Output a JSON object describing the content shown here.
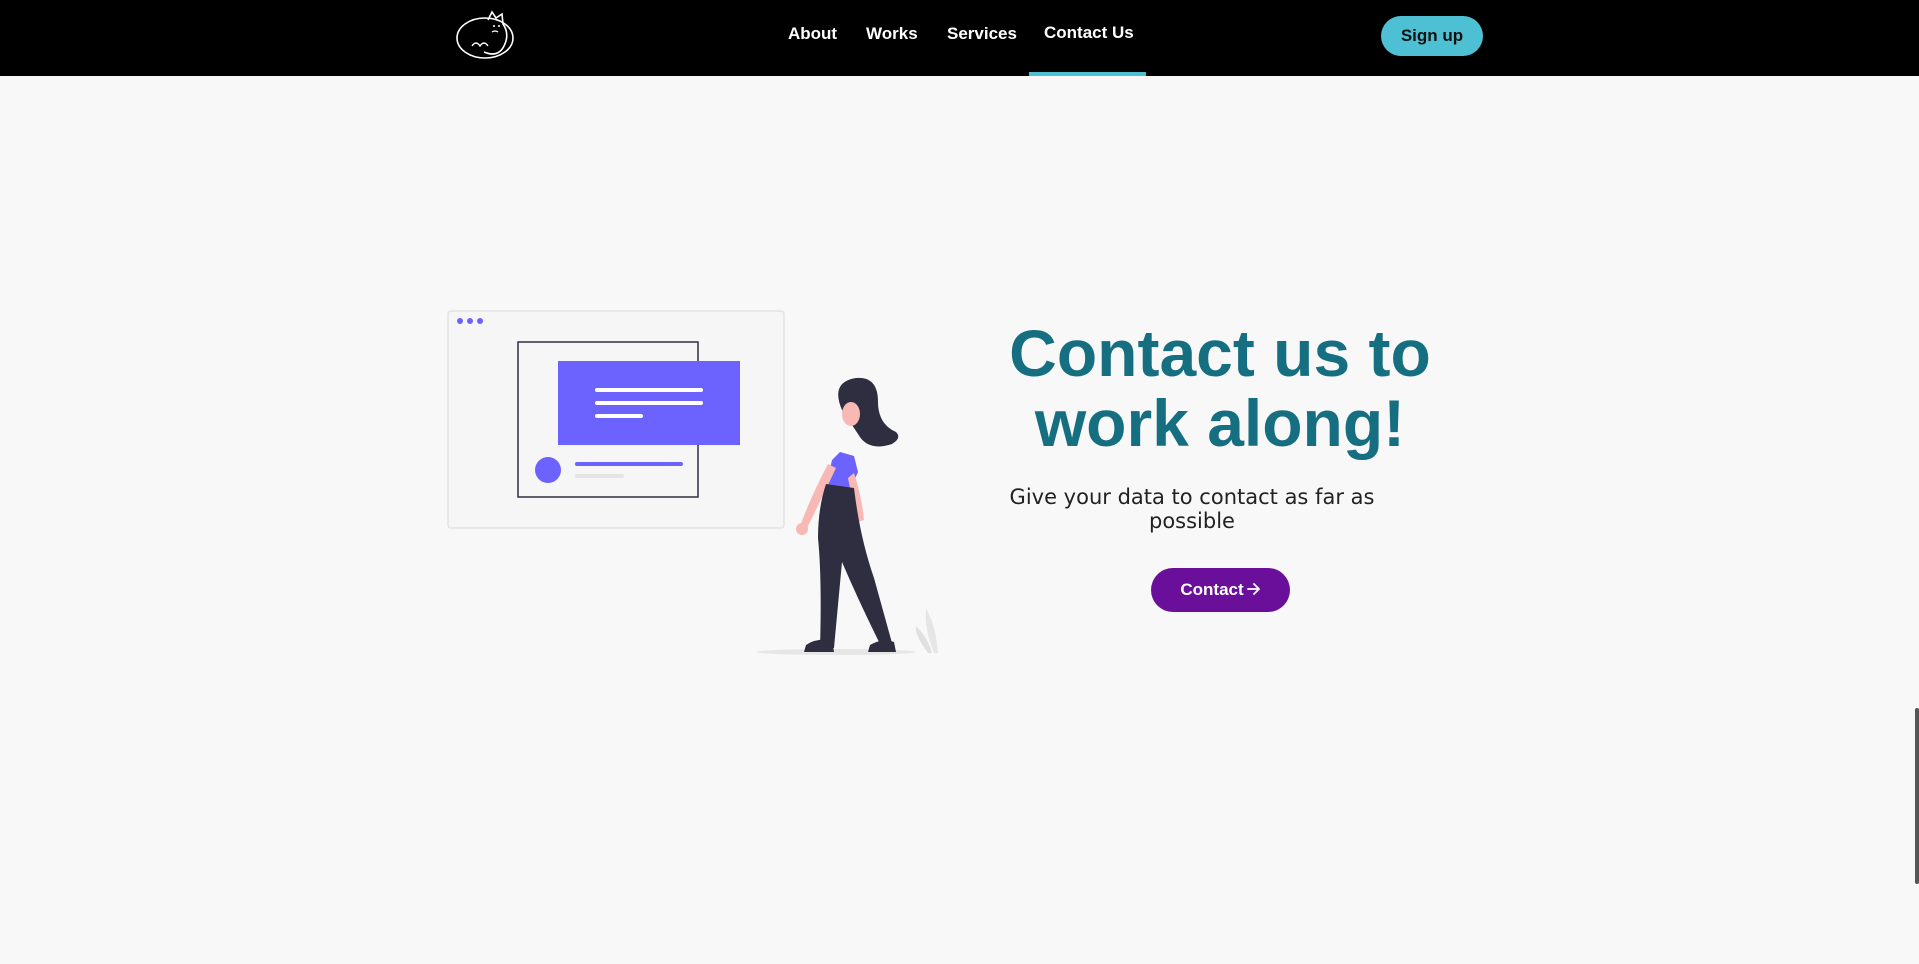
{
  "colors": {
    "nav_bg": "#000000",
    "accent": "#4ec0d4",
    "title": "#166f80",
    "button": "#6a0f99",
    "illustration_purple": "#6c63ff",
    "dark": "#2f2e41"
  },
  "nav": {
    "links": [
      {
        "label": "About"
      },
      {
        "label": "Works"
      },
      {
        "label": "Services"
      },
      {
        "label": "Contact Us",
        "active": true
      }
    ],
    "signup_label": "Sign up",
    "logo_icon": "cat-logo-icon"
  },
  "hero": {
    "title_line1": "Contact us to",
    "title_line2": "work along!",
    "subtitle": "Give your data to contact as far as possible",
    "button_label": "Contact",
    "button_icon": "arrow-right-icon"
  }
}
